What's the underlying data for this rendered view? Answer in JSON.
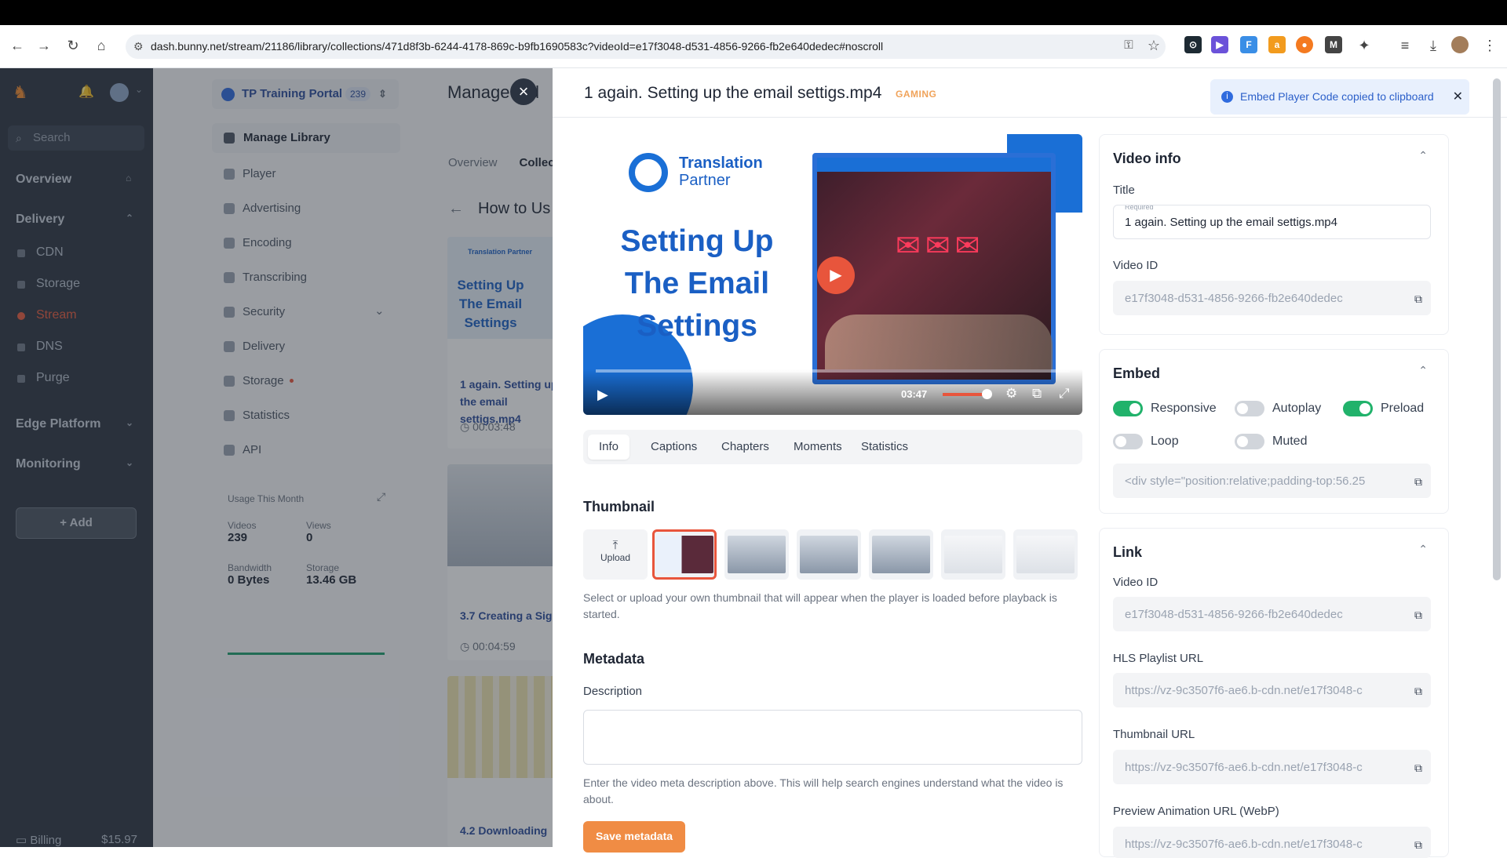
{
  "browser": {
    "url": "dash.bunny.net/stream/21186/library/collections/471d8f3b-6244-4178-869c-b9fb1690583c?videoId=e17f3048-d531-4856-9266-fb2e640dedec#noscroll"
  },
  "sidebar": {
    "search_placeholder": "Search",
    "groups": {
      "overview": "Overview",
      "delivery": "Delivery",
      "edge_platform": "Edge Platform",
      "monitoring": "Monitoring"
    },
    "items": [
      "CDN",
      "Storage",
      "Stream",
      "DNS",
      "Purge"
    ],
    "add_label": "+ Add",
    "billing_label": "Billing",
    "billing_amount": "$15.97"
  },
  "library": {
    "portal_name": "TP Training Portal",
    "portal_count": "239",
    "menu": [
      "Manage Library",
      "Player",
      "Advertising",
      "Encoding",
      "Transcribing",
      "Security",
      "Delivery",
      "Storage",
      "Statistics",
      "API"
    ],
    "usage_title": "Usage This Month",
    "usage": {
      "videos_label": "Videos",
      "videos_value": "239",
      "views_label": "Views",
      "views_value": "0",
      "bandwidth_label": "Bandwidth",
      "bandwidth_value": "0 Bytes",
      "storage_label": "Storage",
      "storage_value": "13.46 GB"
    }
  },
  "collection": {
    "title": "Manage Vid",
    "tab_overview": "Overview",
    "tab_collections": "Collect",
    "back_title": "How to Us",
    "videos": [
      {
        "thumb_text": "Setting Up The Email Settings",
        "title": "1 again. Setting up the email settigs.mp4",
        "duration": "00:03:48"
      },
      {
        "title": "3.7 Creating a Sig",
        "duration": "00:04:59"
      },
      {
        "title": "4.2 Downloading"
      }
    ],
    "thumb_brand": "Translation Partner"
  },
  "panel": {
    "title": "1 again. Setting up the email settigs.mp4",
    "tag": "GAMING",
    "toast": "Embed Player Code copied to clipboard",
    "player": {
      "brand_line1": "Translation",
      "brand_line2": "Partner",
      "headline": "Setting Up The Email Settings",
      "time": "03:47"
    },
    "tabs": [
      "Info",
      "Captions",
      "Chapters",
      "Moments",
      "Statistics"
    ],
    "thumbnail_title": "Thumbnail",
    "upload_label": "Upload",
    "thumbnail_hint": "Select or upload your own thumbnail that will appear when the player is loaded before playback is started.",
    "metadata_title": "Metadata",
    "description_label": "Description",
    "description_hint": "Enter the video meta description above. This will help search engines understand what the video is about.",
    "save_metadata": "Save metadata"
  },
  "video_info": {
    "title": "Video info",
    "title_label": "Title",
    "required_label": "Required",
    "title_value": "1 again. Setting up the email settigs.mp4",
    "video_id_label": "Video ID",
    "video_id": "e17f3048-d531-4856-9266-fb2e640dedec"
  },
  "embed": {
    "title": "Embed",
    "toggles": [
      {
        "label": "Responsive",
        "on": true
      },
      {
        "label": "Autoplay",
        "on": false
      },
      {
        "label": "Preload",
        "on": true
      },
      {
        "label": "Loop",
        "on": false
      },
      {
        "label": "Muted",
        "on": false
      }
    ],
    "code": "<div style=\"position:relative;padding-top:56.25"
  },
  "link": {
    "title": "Link",
    "video_id_label": "Video ID",
    "video_id": "e17f3048-d531-4856-9266-fb2e640dedec",
    "hls_label": "HLS Playlist URL",
    "hls_value": "https://vz-9c3507f6-ae6.b-cdn.net/e17f3048-c",
    "thumb_label": "Thumbnail URL",
    "thumb_value": "https://vz-9c3507f6-ae6.b-cdn.net/e17f3048-c",
    "preview_label": "Preview Animation URL (WebP)",
    "preview_value": "https://vz-9c3507f6-ae6.b-cdn.net/e17f3048-c"
  },
  "colors": {
    "accent": "#e8553c",
    "brand_blue": "#1a6fd6",
    "toggle_on": "#21b26b",
    "sidebar_bg": "#2c3440"
  }
}
